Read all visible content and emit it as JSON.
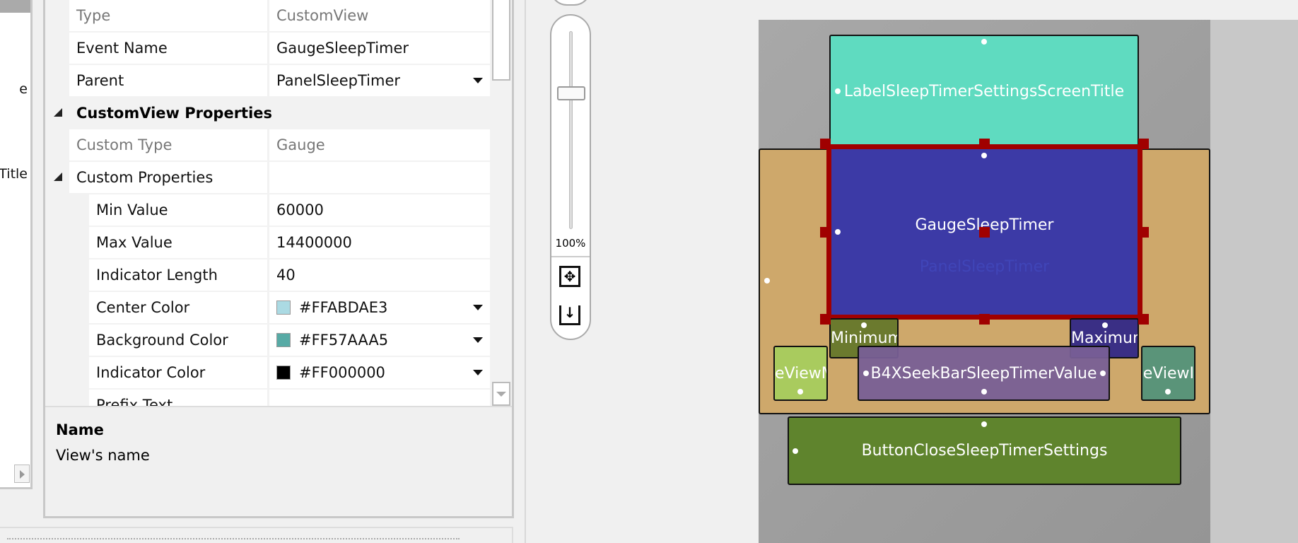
{
  "tree": {
    "items": [
      "e",
      "Title"
    ]
  },
  "properties": {
    "rows": [
      {
        "key": "Type",
        "value": "CustomView"
      },
      {
        "key": "Event Name",
        "value": "GaugeSleepTimer"
      },
      {
        "key": "Parent",
        "value": "PanelSleepTimer"
      }
    ],
    "category": "CustomView Properties",
    "custom_type": {
      "key": "Custom Type",
      "value": "Gauge"
    },
    "custom_props_label": "Custom Properties",
    "custom": [
      {
        "key": "Min Value",
        "value": "60000"
      },
      {
        "key": "Max Value",
        "value": "14400000"
      },
      {
        "key": "Indicator Length",
        "value": "40"
      },
      {
        "key": "Center Color",
        "value": "#FFABDAE3",
        "swatch": "#abdae3"
      },
      {
        "key": "Background Color",
        "value": "#FF57AAA5",
        "swatch": "#57aaa5"
      },
      {
        "key": "Indicator Color",
        "value": "#FF000000",
        "swatch": "#000000"
      },
      {
        "key": "Prefix Text",
        "value": ""
      }
    ]
  },
  "description": {
    "title": "Name",
    "text": "View's name"
  },
  "zoom": {
    "level": "100%",
    "slider_fraction": 0.3
  },
  "designer": {
    "title_label": "LabelSleepTimerSettingsScreenTitle",
    "gauge": "GaugeSleepTimer",
    "panel": "PanelSleepTimer",
    "minimum": "Minimum",
    "maximum": "Maximum",
    "left_view": "eViewM",
    "right_view": "geViewI",
    "seekbar": "B4XSeekBarSleepTimerValue",
    "button": "ButtonCloseSleepTimerSettings"
  }
}
